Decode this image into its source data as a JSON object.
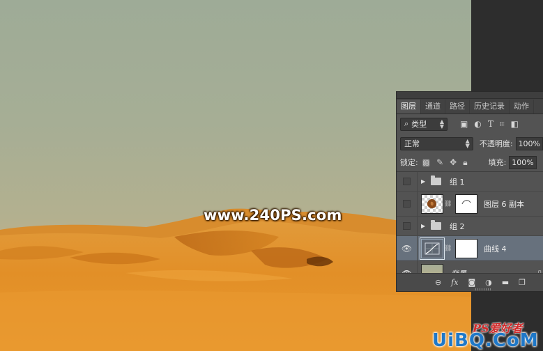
{
  "watermark": {
    "text": "www.240PS.com"
  },
  "tabs": [
    {
      "label": "图层",
      "active": true
    },
    {
      "label": "通道",
      "active": false
    },
    {
      "label": "路径",
      "active": false
    },
    {
      "label": "历史记录",
      "active": false
    },
    {
      "label": "动作",
      "active": false
    }
  ],
  "filter": {
    "search_glyph": "⌕",
    "kind_label": "类型",
    "icons": [
      "image-filter-icon",
      "adjustment-filter-icon",
      "type-filter-icon",
      "shape-filter-icon",
      "smart-object-filter-icon"
    ]
  },
  "blend": {
    "mode": "正常",
    "opacity_label": "不透明度:",
    "opacity_value": "100%"
  },
  "lock": {
    "label": "锁定:",
    "fill_label": "填充:",
    "fill_value": "100%"
  },
  "layers": [
    {
      "name": "组 1",
      "type": "group",
      "visible": false
    },
    {
      "name": "图层 6 副本",
      "type": "pixel-masked",
      "visible": false
    },
    {
      "name": "组 2",
      "type": "group",
      "visible": false
    },
    {
      "name": "曲线 4",
      "type": "curves-adjustment",
      "visible": true,
      "selected": true
    },
    {
      "name": "背景",
      "type": "background",
      "visible": true,
      "locked": true
    }
  ],
  "bottom_bar": {
    "fx_label": "fx",
    "icons": [
      "link-layers-icon",
      "fx-icon",
      "add-mask-icon",
      "new-adjustment-icon",
      "new-group-icon",
      "new-layer-icon"
    ]
  },
  "site_logo": {
    "small": "PS爱好者",
    "main": "UiBQ.CoM"
  },
  "colors": {
    "panel_bg": "#535353",
    "selected_layer": "#67717d",
    "sky": "#a6ae95",
    "sand": "#e6952e",
    "logo_blue": "#1f78c8",
    "logo_red": "#d12b2b"
  }
}
